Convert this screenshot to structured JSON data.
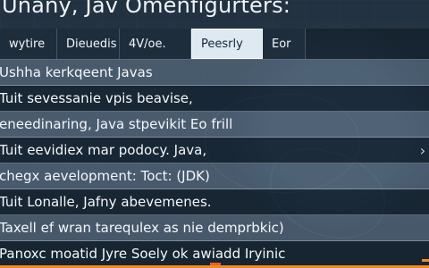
{
  "window": {
    "title": "Unany, Jav Omenfigurters:"
  },
  "tabs": [
    {
      "label": "wytire"
    },
    {
      "label": "Dieuedis"
    },
    {
      "label": "4V/oe."
    },
    {
      "label": "Peesrly"
    },
    {
      "label": "Eor"
    }
  ],
  "list": {
    "items": [
      {
        "text": "Ushha kerkqeent Javas"
      },
      {
        "text": "Tuit sevessanie vpis beavise,"
      },
      {
        "text": "eneedinaring, Java stpevikit Eo frill"
      },
      {
        "text": "Tuit eevidiex mar podocy. Java,",
        "chevron": "›"
      },
      {
        "text": "chegx aevelopment: Toct: (JDK)"
      },
      {
        "text": "Tuit Lonalle, Jafny abevemenes."
      },
      {
        "text": "Taxell ef wran tarequlex as nie demprbkic)"
      },
      {
        "text": "Panoxc moatid Jyre Soely ok awiadd Iryinic"
      }
    ]
  },
  "colors": {
    "accent": "#ef8a22",
    "selected_tab": "#dfe9f2",
    "background": "#243443"
  },
  "icons": {
    "chevron": "chevron-right-icon"
  }
}
